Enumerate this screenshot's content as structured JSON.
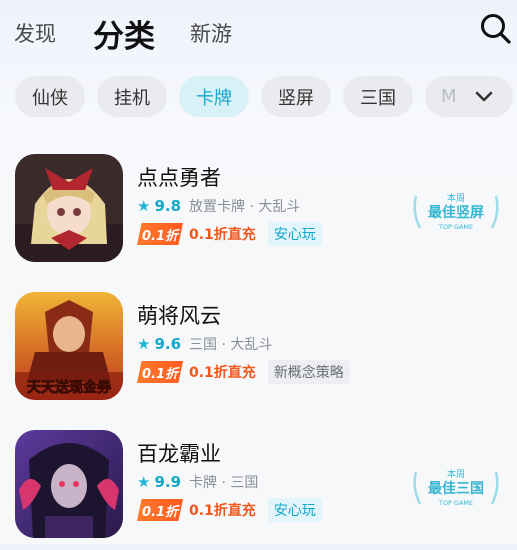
{
  "top_tabs": [
    "发现",
    "分类",
    "新游"
  ],
  "chips": [
    "仙侠",
    "挂机",
    "卡牌",
    "竖屏",
    "三国",
    "M"
  ],
  "icons": {
    "search": "search-icon",
    "expand": "chevron-down-icon"
  },
  "colors": {
    "accent": "#13a7c9",
    "discount": "#f2571c"
  },
  "games": [
    {
      "name": "点点勇者",
      "score": "9.8",
      "tags_line": "放置卡牌 · 大乱斗",
      "discount_badge": "0.1折",
      "discount_text": "0.1折直充",
      "tag": "安心玩",
      "award": {
        "line1": "本周",
        "line2": "最佳竖屏",
        "line3": "TOP GAME"
      }
    },
    {
      "name": "萌将风云",
      "score": "9.6",
      "tags_line": "三国 · 大乱斗",
      "discount_badge": "0.1折",
      "discount_text": "0.1折直充",
      "tag": "新概念策略",
      "icon_caption": "天天送现金券"
    },
    {
      "name": "百龙霸业",
      "score": "9.9",
      "tags_line": "卡牌 · 三国",
      "discount_badge": "0.1折",
      "discount_text": "0.1折直充",
      "tag": "安心玩",
      "award": {
        "line1": "本周",
        "line2": "最佳三国",
        "line3": "TOP GAME"
      }
    }
  ]
}
